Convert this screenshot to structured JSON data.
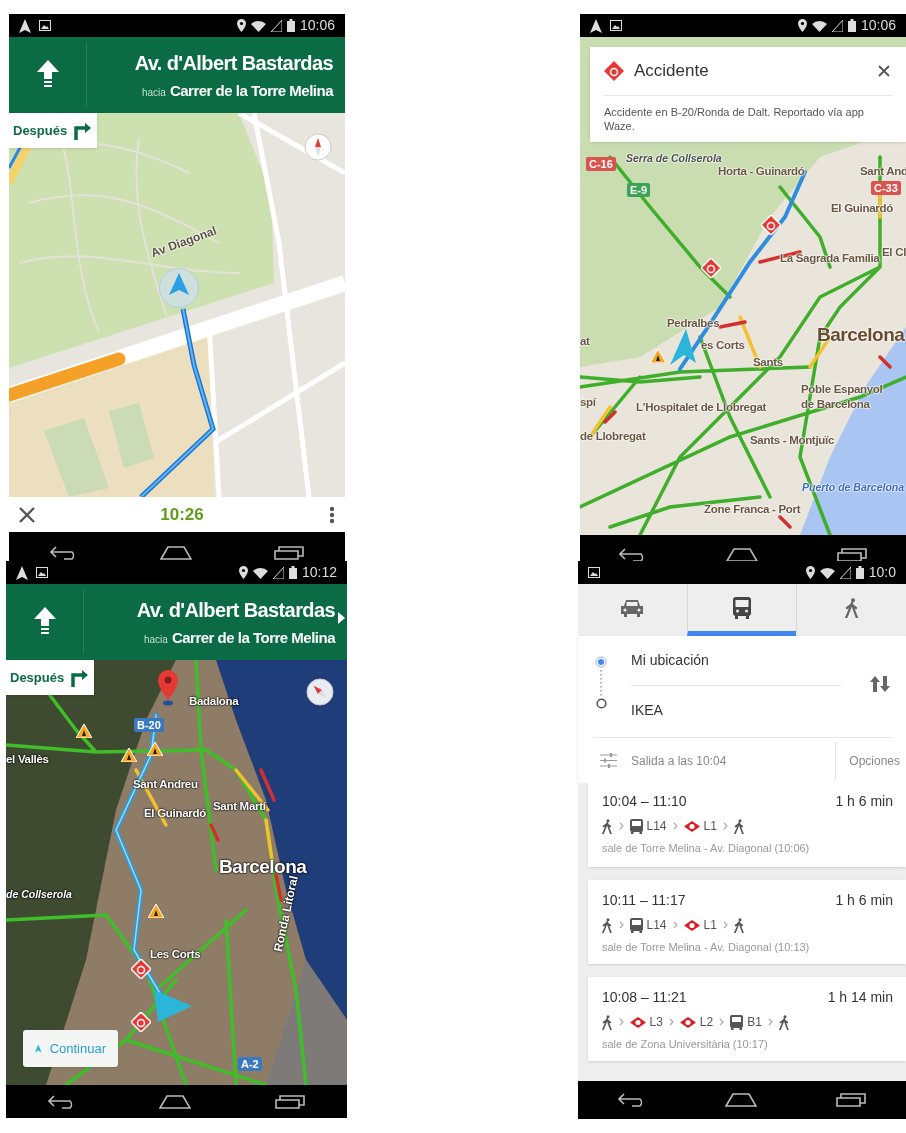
{
  "screens": [
    {
      "kind": "navigation",
      "status_bar": {
        "time": "10:06"
      },
      "instruction": {
        "street": "Av. d'Albert Bastardas",
        "toward_label": "hacia",
        "toward_street": "Carrer de la Torre Melina",
        "more": false
      },
      "then_label": "Después",
      "map": {
        "labels": [
          {
            "kind": "street",
            "text": "Av Diagonal"
          }
        ]
      },
      "footer": {
        "arrival_time": "10:26"
      }
    },
    {
      "kind": "traffic",
      "status_bar": {
        "time": "10:06"
      },
      "alert": {
        "title": "Accidente",
        "body": "Accidente en B-20/Ronda de Dalt. Reportado vía app Waze."
      },
      "map": {
        "labels": [
          {
            "kind": "area",
            "text": "Serra de Collserola"
          },
          {
            "kind": "shield",
            "text": "C-16",
            "color": "#d9534f"
          },
          {
            "kind": "place",
            "text": "Horta - Guinardó"
          },
          {
            "kind": "place",
            "text": "Sant And"
          },
          {
            "kind": "shield",
            "text": "C-33",
            "color": "#d9534f"
          },
          {
            "kind": "shield",
            "text": "E-9",
            "color": "#3aa655"
          },
          {
            "kind": "place",
            "text": "El Guinardó"
          },
          {
            "kind": "place",
            "text": "La Sagrada Família"
          },
          {
            "kind": "place",
            "text": "El Cl"
          },
          {
            "kind": "place",
            "text": "Pedralbes"
          },
          {
            "kind": "place",
            "text": "at"
          },
          {
            "kind": "place",
            "text": "es Corts"
          },
          {
            "kind": "city",
            "text": "Barcelona"
          },
          {
            "kind": "place",
            "text": "Sants"
          },
          {
            "kind": "place",
            "text": "spí"
          },
          {
            "kind": "place",
            "text": "L'Hospitalet de Llobregat"
          },
          {
            "kind": "place",
            "text": "Poble Espanyol de Barcelona"
          },
          {
            "kind": "place",
            "text": "de Llobregat"
          },
          {
            "kind": "place",
            "text": "Sants - Montjuïc"
          },
          {
            "kind": "water",
            "text": "Puerto de Barcelona"
          },
          {
            "kind": "place",
            "text": "Zone Franca - Port"
          }
        ]
      }
    },
    {
      "kind": "navigation",
      "status_bar": {
        "time": "10:12"
      },
      "instruction": {
        "street": "Av. d'Albert Bastardas",
        "toward_label": "hacia",
        "toward_street": "Carrer de la Torre Melina",
        "more": true
      },
      "then_label": "Después",
      "map": {
        "labels": [
          {
            "kind": "place",
            "text": "Badalona"
          },
          {
            "kind": "shield",
            "text": "B-20",
            "color": "#3b78c2"
          },
          {
            "kind": "place",
            "text": "el Vallès"
          },
          {
            "kind": "place",
            "text": "Sant Andreu"
          },
          {
            "kind": "place",
            "text": "El Guinardó"
          },
          {
            "kind": "place",
            "text": "Sant Martí"
          },
          {
            "kind": "city",
            "text": "Barcelona"
          },
          {
            "kind": "area",
            "text": "de Collserola"
          },
          {
            "kind": "place",
            "text": "Les Corts"
          },
          {
            "kind": "street",
            "text": "Ronda Litoral"
          },
          {
            "kind": "shield",
            "text": "A-2",
            "color": "#3b78c2"
          }
        ]
      },
      "continue_label": "Continuar"
    },
    {
      "kind": "directions",
      "status_bar": {
        "time": "10:0"
      },
      "modes": [
        {
          "kind": "car",
          "selected": false
        },
        {
          "kind": "transit",
          "selected": true
        },
        {
          "kind": "walk",
          "selected": false
        }
      ],
      "origin": "Mi ubicación",
      "destination": "IKEA",
      "departure": "Salida a las 10:04",
      "options_label": "Opciones",
      "routes": [
        {
          "times": "10:04 – 11:10",
          "duration": "1 h 6 min",
          "steps": [
            {
              "kind": "walk"
            },
            {
              "kind": "bus",
              "line": "L14"
            },
            {
              "kind": "metro",
              "line": "L1"
            },
            {
              "kind": "walk"
            }
          ],
          "departs": "sale de Torre Melina - Av. Diagonal (10:06)"
        },
        {
          "times": "10:11 – 11:17",
          "duration": "1 h 6 min",
          "steps": [
            {
              "kind": "walk"
            },
            {
              "kind": "bus",
              "line": "L14"
            },
            {
              "kind": "metro",
              "line": "L1"
            },
            {
              "kind": "walk"
            }
          ],
          "departs": "sale de Torre Melina - Av. Diagonal (10:13)"
        },
        {
          "times": "10:08 – 11:21",
          "duration": "1 h 14 min",
          "steps": [
            {
              "kind": "walk"
            },
            {
              "kind": "metro",
              "line": "L3"
            },
            {
              "kind": "metro",
              "line": "L2"
            },
            {
              "kind": "bus",
              "line": "B1"
            },
            {
              "kind": "walk"
            }
          ],
          "departs": "sale de Zona Universitària (10:17)"
        }
      ]
    }
  ]
}
